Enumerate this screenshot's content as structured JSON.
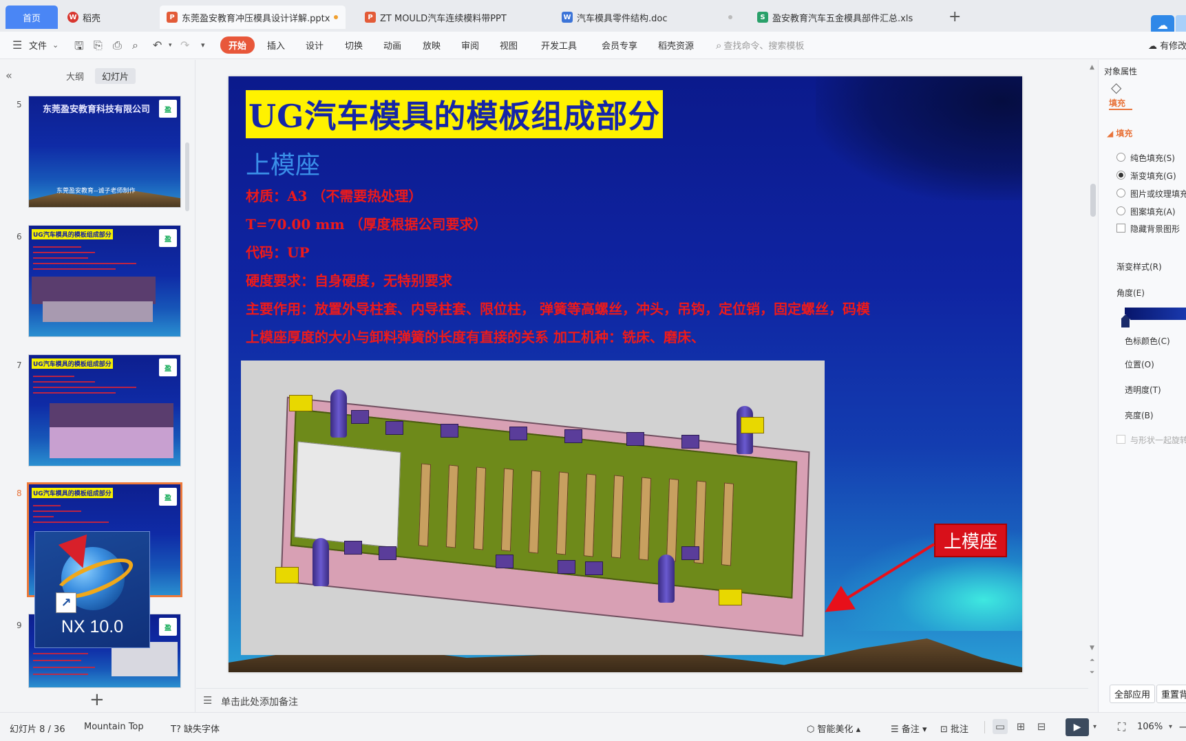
{
  "tabs": [
    {
      "label": "首页",
      "type": "home"
    },
    {
      "label": "稻壳",
      "type": "wps"
    },
    {
      "label": "东莞盈安教育冲压模具设计详解.pptx",
      "type": "ppt",
      "active": true
    },
    {
      "label": "ZT MOULD汽车连续模料带PPT",
      "type": "ppt"
    },
    {
      "label": "汽车模具零件结构.doc",
      "type": "doc"
    },
    {
      "label": "盈安教育汽车五金模具部件汇总.xls",
      "type": "xls"
    }
  ],
  "ribbon": {
    "menu_label": "文件",
    "items": [
      "开始",
      "插入",
      "设计",
      "切换",
      "动画",
      "放映",
      "审阅",
      "视图",
      "开发工具",
      "会员专享",
      "稻壳资源"
    ],
    "search_placeholder": "查找命令、搜索模板",
    "modify_label": "有修改"
  },
  "left_panel": {
    "tab_outline": "大纲",
    "tab_slides": "幻灯片",
    "thumbs": [
      {
        "num": "5",
        "title": "东莞盈安教育科技有限公司",
        "footer": "东莞盈安教育--诚子老师制作"
      },
      {
        "num": "6",
        "title": "UG汽车模具的模板组成部分"
      },
      {
        "num": "7",
        "title": "UG汽车模具的模板组成部分"
      },
      {
        "num": "8",
        "title": "UG汽车模具的模板组成部分",
        "selected": true
      },
      {
        "num": "9",
        "title": ""
      }
    ],
    "nx_label": "NX 10.0"
  },
  "slide": {
    "title": "UG汽车模具的模板组成部分",
    "subtitle": "上模座",
    "lines": [
      "材质：A3 （不需要热处理）",
      "T=70.00 mm （厚度根据公司要求）",
      "代码：UP",
      "硬度要求：自身硬度，无特别要求",
      "主要作用：放置外导柱套、内导柱套、限位柱， 弹簧等高螺丝，冲头，吊钩，定位销，固定螺丝，码模",
      "上模座厚度的大小与卸料弹簧的长度有直接的关系    加工机种：铣床、磨床、"
    ],
    "callout": "上模座"
  },
  "notes_placeholder": "单击此处添加备注",
  "right_panel": {
    "header": "对象属性",
    "fill_tab": "填充",
    "fill_section": "填充",
    "options": [
      {
        "label": "纯色填充(S)",
        "checked": false
      },
      {
        "label": "渐变填充(G)",
        "checked": true
      },
      {
        "label": "图片或纹理填充",
        "checked": false
      },
      {
        "label": "图案填充(A)",
        "checked": false
      }
    ],
    "hide_bg": "隐藏背景图形",
    "gradient_style": "渐变样式(R)",
    "angle": "角度(E)",
    "stop_color": "色标颜色(C)",
    "position": "位置(O)",
    "transparency": "透明度(T)",
    "brightness": "亮度(B)",
    "rotate_with_shape": "与形状一起旋转",
    "apply_all": "全部应用",
    "reset": "重置背景"
  },
  "status": {
    "slide_info": "幻灯片 8 / 36",
    "theme": "Mountain Top",
    "missing_font": "缺失字体",
    "beautify": "智能美化",
    "notes": "备注",
    "comments": "批注",
    "zoom": "106%"
  },
  "colors": {
    "accent_orange": "#e8573a",
    "slide_title_bg": "#fff200",
    "slide_text_red": "#ee1a1a",
    "slide_bg_top": "#0b1a8c",
    "home_tab": "#4a86f5"
  }
}
